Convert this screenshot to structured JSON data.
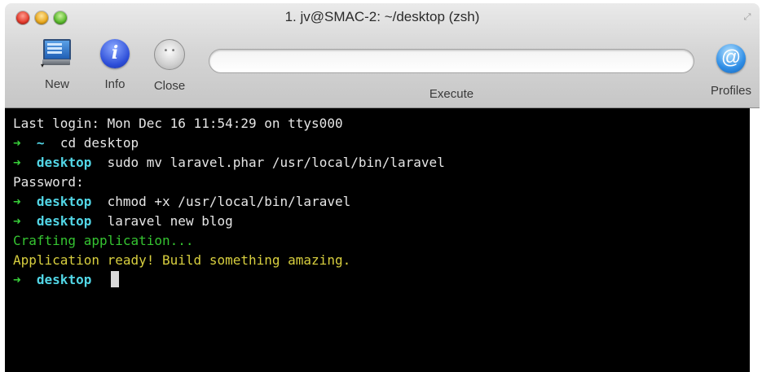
{
  "window": {
    "title": "1. jv@SMAC-2: ~/desktop (zsh)"
  },
  "toolbar": {
    "new_label": "New",
    "info_label": "Info",
    "close_label": "Close",
    "execute_label": "Execute",
    "execute_value": "",
    "profiles_label": "Profiles",
    "info_glyph": "i",
    "profiles_glyph": "@"
  },
  "terminal": {
    "arrow": "➜",
    "last_login": "Last login: Mon Dec 16 11:54:29 on ttys000",
    "cmd1": {
      "prompt": "~",
      "command": "cd desktop"
    },
    "cmd2": {
      "prompt": "desktop",
      "command": "sudo mv laravel.phar /usr/local/bin/laravel"
    },
    "password": "Password:",
    "cmd3": {
      "prompt": "desktop",
      "command": "chmod +x /usr/local/bin/laravel"
    },
    "cmd4": {
      "prompt": "desktop",
      "command": "laravel new blog"
    },
    "out_crafting": "Crafting application...",
    "out_ready": "Application ready! Build something amazing.",
    "cmd5": {
      "prompt": "desktop",
      "command": ""
    }
  },
  "colors": {
    "arrow": "#38d13a",
    "prompt_dir": "#52d6e6",
    "out_green": "#35c431",
    "out_yellow": "#d8cf3f",
    "terminal_bg": "#000000"
  }
}
